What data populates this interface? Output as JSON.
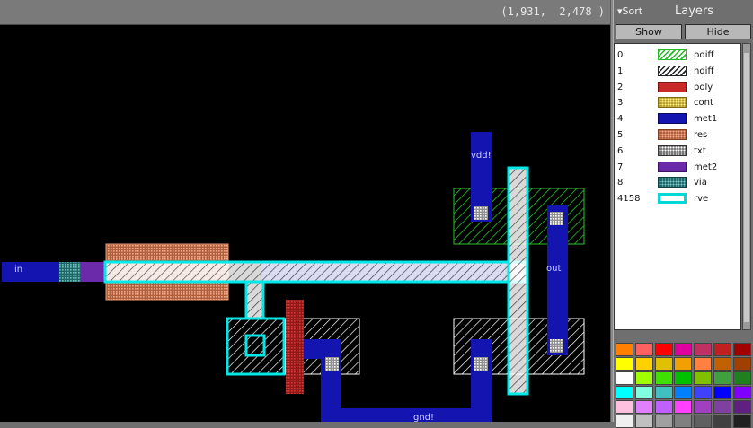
{
  "header": {
    "coords": "(1,931,  2,478 )"
  },
  "panel": {
    "sort_label": "Sort",
    "title": "Layers",
    "show_label": "Show",
    "hide_label": "Hide",
    "layers": [
      {
        "num": "0",
        "name": "pdiff",
        "color": "#22bb22",
        "style": "hatch-green"
      },
      {
        "num": "1",
        "name": "ndiff",
        "color": "#ffffff",
        "style": "hatch-white"
      },
      {
        "num": "2",
        "name": "poly",
        "color": "#cc2222",
        "style": "solid-red"
      },
      {
        "num": "3",
        "name": "cont",
        "color": "#f0e060",
        "style": "dots-yellow"
      },
      {
        "num": "4",
        "name": "met1",
        "color": "#1010a8",
        "style": "solid-blue"
      },
      {
        "num": "5",
        "name": "res",
        "color": "#e0906a",
        "style": "dots-orange"
      },
      {
        "num": "6",
        "name": "txt",
        "color": "#ffffff",
        "style": "dots-white"
      },
      {
        "num": "7",
        "name": "met2",
        "color": "#6a2aaa",
        "style": "solid-purple"
      },
      {
        "num": "8",
        "name": "via",
        "color": "#40a0a0",
        "style": "dots-teal"
      },
      {
        "num": "4158",
        "name": "rve",
        "color": "#00e0e0",
        "style": "outline-cyan"
      }
    ],
    "palette": [
      "#ff8000",
      "#ff6060",
      "#ff0000",
      "#e000a0",
      "#c03060",
      "#c02020",
      "#a00000",
      "#ffff00",
      "#ffd000",
      "#e0c000",
      "#f0a000",
      "#ff8040",
      "#c06000",
      "#a04000",
      "#ffffff",
      "#a0ff00",
      "#40e000",
      "#00c000",
      "#80c000",
      "#40a040",
      "#208020",
      "#00ffff",
      "#80ffe0",
      "#40c0c0",
      "#0080ff",
      "#4040ff",
      "#0000ff",
      "#8000ff",
      "#ffc0e0",
      "#e080ff",
      "#c060ff",
      "#ff40ff",
      "#a040c0",
      "#8040a0",
      "#602080",
      "#f0f0f0",
      "#c0c0c0",
      "#a0a0a0",
      "#808080",
      "#606060",
      "#404040",
      "#202020"
    ]
  },
  "canvas": {
    "labels": {
      "in": "in",
      "vdd": "vdd!",
      "out": "out",
      "gnd": "gnd!"
    }
  }
}
